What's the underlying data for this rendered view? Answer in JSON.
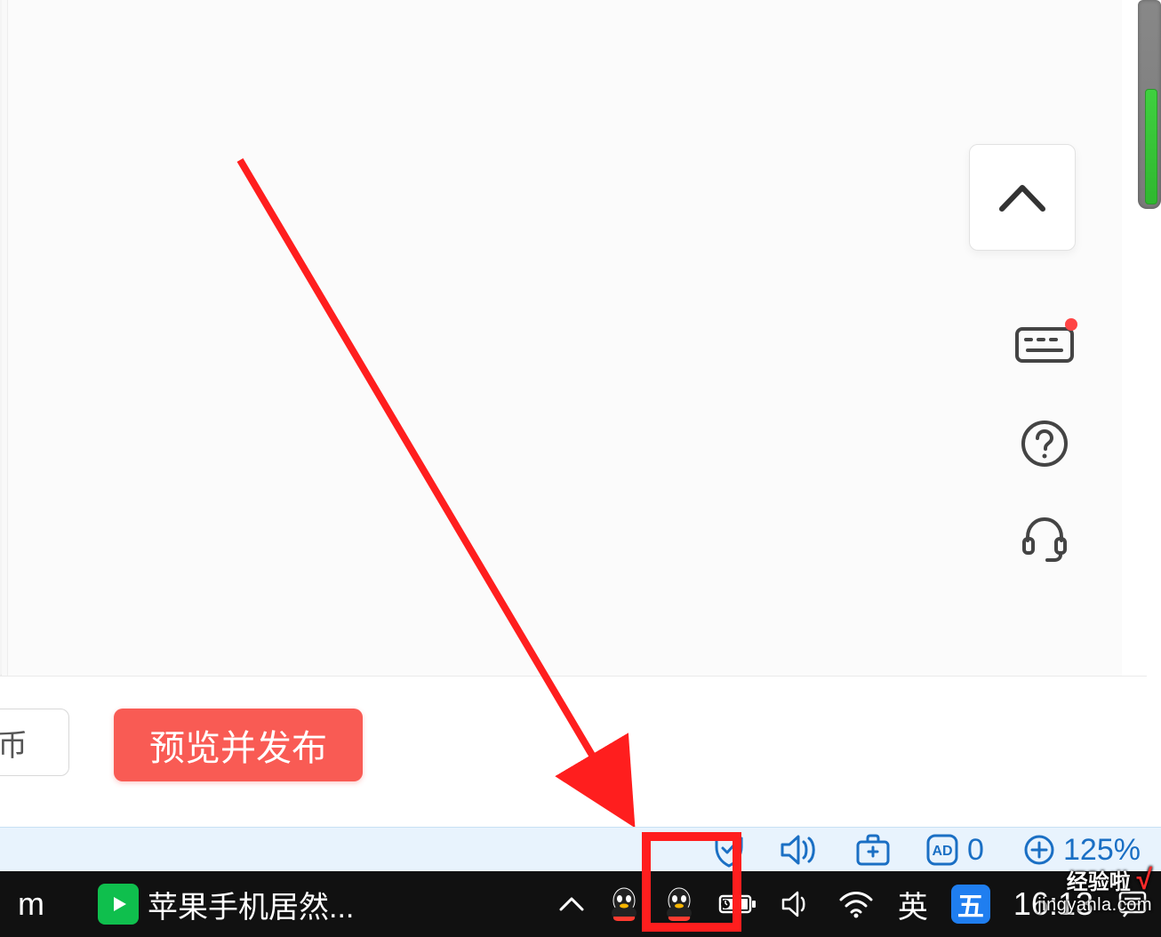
{
  "editor": {
    "secondary_btn_label": "币",
    "primary_btn_label": "预览并发布"
  },
  "side_toolbar": {
    "scroll_up": "chevron-up",
    "keyboard_has_notification": true
  },
  "browser_status": {
    "ad_block_count": "0",
    "zoom_label": "125%"
  },
  "taskbar": {
    "left_fragment": "m",
    "app_title": "苹果手机居然...",
    "ime_lang": "英",
    "ime_engine": "五",
    "clock": "16:13"
  },
  "watermark": {
    "line1": "经验啦",
    "line2": "jingyanla.com"
  },
  "colors": {
    "primary_red": "#f95b54",
    "annotation_red": "#ff1e1e",
    "browser_blue": "#1a6fc4",
    "taskbar_bg": "#111111",
    "ime_blue": "#1f7ef0",
    "iqiyi_green": "#0fbf4d"
  }
}
